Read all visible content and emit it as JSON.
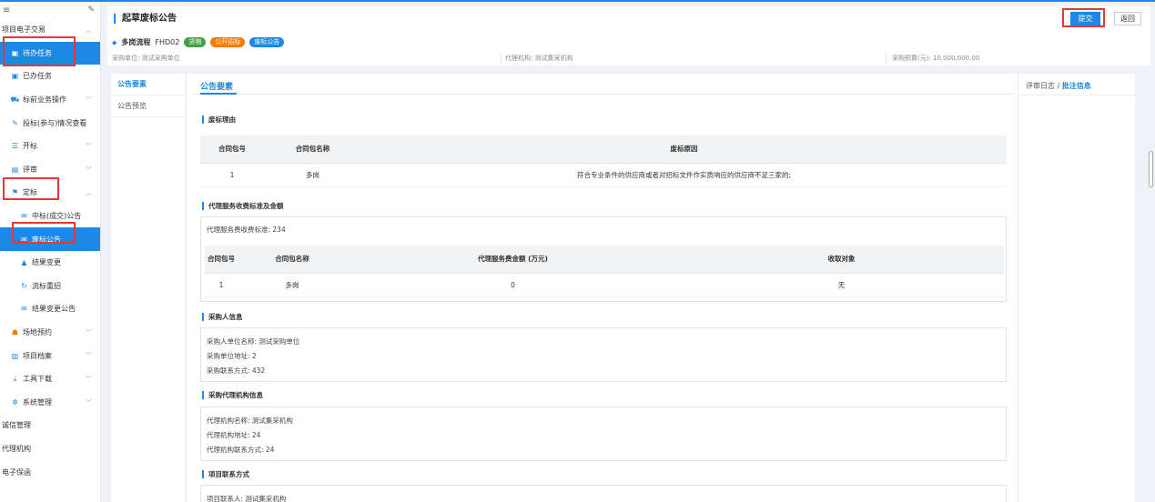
{
  "sidebar": {
    "top_icons": [
      "menu-icon",
      "pin-icon"
    ],
    "items": [
      {
        "label": "项目电子交易",
        "chevron": "︿"
      },
      {
        "label": "待办任务",
        "active": true
      },
      {
        "label": "已办任务"
      },
      {
        "label": "标前业务操作",
        "chevron": "﹀"
      },
      {
        "label": "投标(参与)情况查看"
      },
      {
        "label": "开标",
        "chevron": "﹀"
      },
      {
        "label": "评审",
        "chevron": "﹀"
      },
      {
        "label": "定标",
        "chevron": "︿"
      },
      {
        "label": "中标(成交)公告"
      },
      {
        "label": "废标公告",
        "active": true
      },
      {
        "label": "结果变更"
      },
      {
        "label": "流标重招"
      },
      {
        "label": "结果变更公告"
      },
      {
        "label": "场地预约",
        "chevron": "﹀"
      },
      {
        "label": "项目档案",
        "chevron": "﹀"
      },
      {
        "label": "工具下载",
        "chevron": "﹀"
      },
      {
        "label": "系统管理",
        "chevron": "﹀"
      },
      {
        "label": "诚信管理"
      },
      {
        "label": "代理机构"
      },
      {
        "label": "电子保函"
      }
    ]
  },
  "header": {
    "title": "起草废标公告",
    "submit_label": "提交",
    "back_label": "返回",
    "flow_name": "多岗流程",
    "flow_code": "FHD02",
    "tags": [
      "货物",
      "公开招标",
      "废标公告"
    ],
    "purchaser": "采购单位: 测试采购单位",
    "agency": "代理机构: 测试集采机构",
    "budget": "采购预算(元): 10,000,000.00"
  },
  "tabs": [
    "公告要素",
    "公告预览"
  ],
  "content": {
    "tab_label": "公告要素",
    "sec1_title": "废标理由",
    "table1": {
      "headers": [
        "合同包号",
        "合同包名称",
        "废标原因"
      ],
      "rows": [
        [
          "1",
          "多岗",
          "符合专业条件的供应商或者对招标文件作实质响应的供应商不足三家的;"
        ]
      ]
    },
    "sec2_title": "代理服务收费标准及金额",
    "fee_standard": "代理服务费收费标准: 234",
    "table2": {
      "headers": [
        "合同包号",
        "合同包名称",
        "代理服务费金额 (万元)",
        "收取对象"
      ],
      "rows": [
        [
          "1",
          "多岗",
          "0",
          "无"
        ]
      ]
    },
    "sec3_title": "采购人信息",
    "purchaser_lines": [
      "采购人单位名称: 测试采购单位",
      "采购单位地址: 2",
      "采购联系方式: 432"
    ],
    "sec4_title": "采购代理机构信息",
    "agency_lines": [
      "代理机构名称: 测试集采机构",
      "代理机构地址: 24",
      "代理机构联系方式: 24"
    ],
    "sec5_title": "项目联系方式",
    "contact_lines": [
      "项目联系人: 测试集采机构"
    ]
  },
  "right_panel": {
    "log_label": "评审日志",
    "sep": " / ",
    "annotation_label": "批注信息"
  }
}
